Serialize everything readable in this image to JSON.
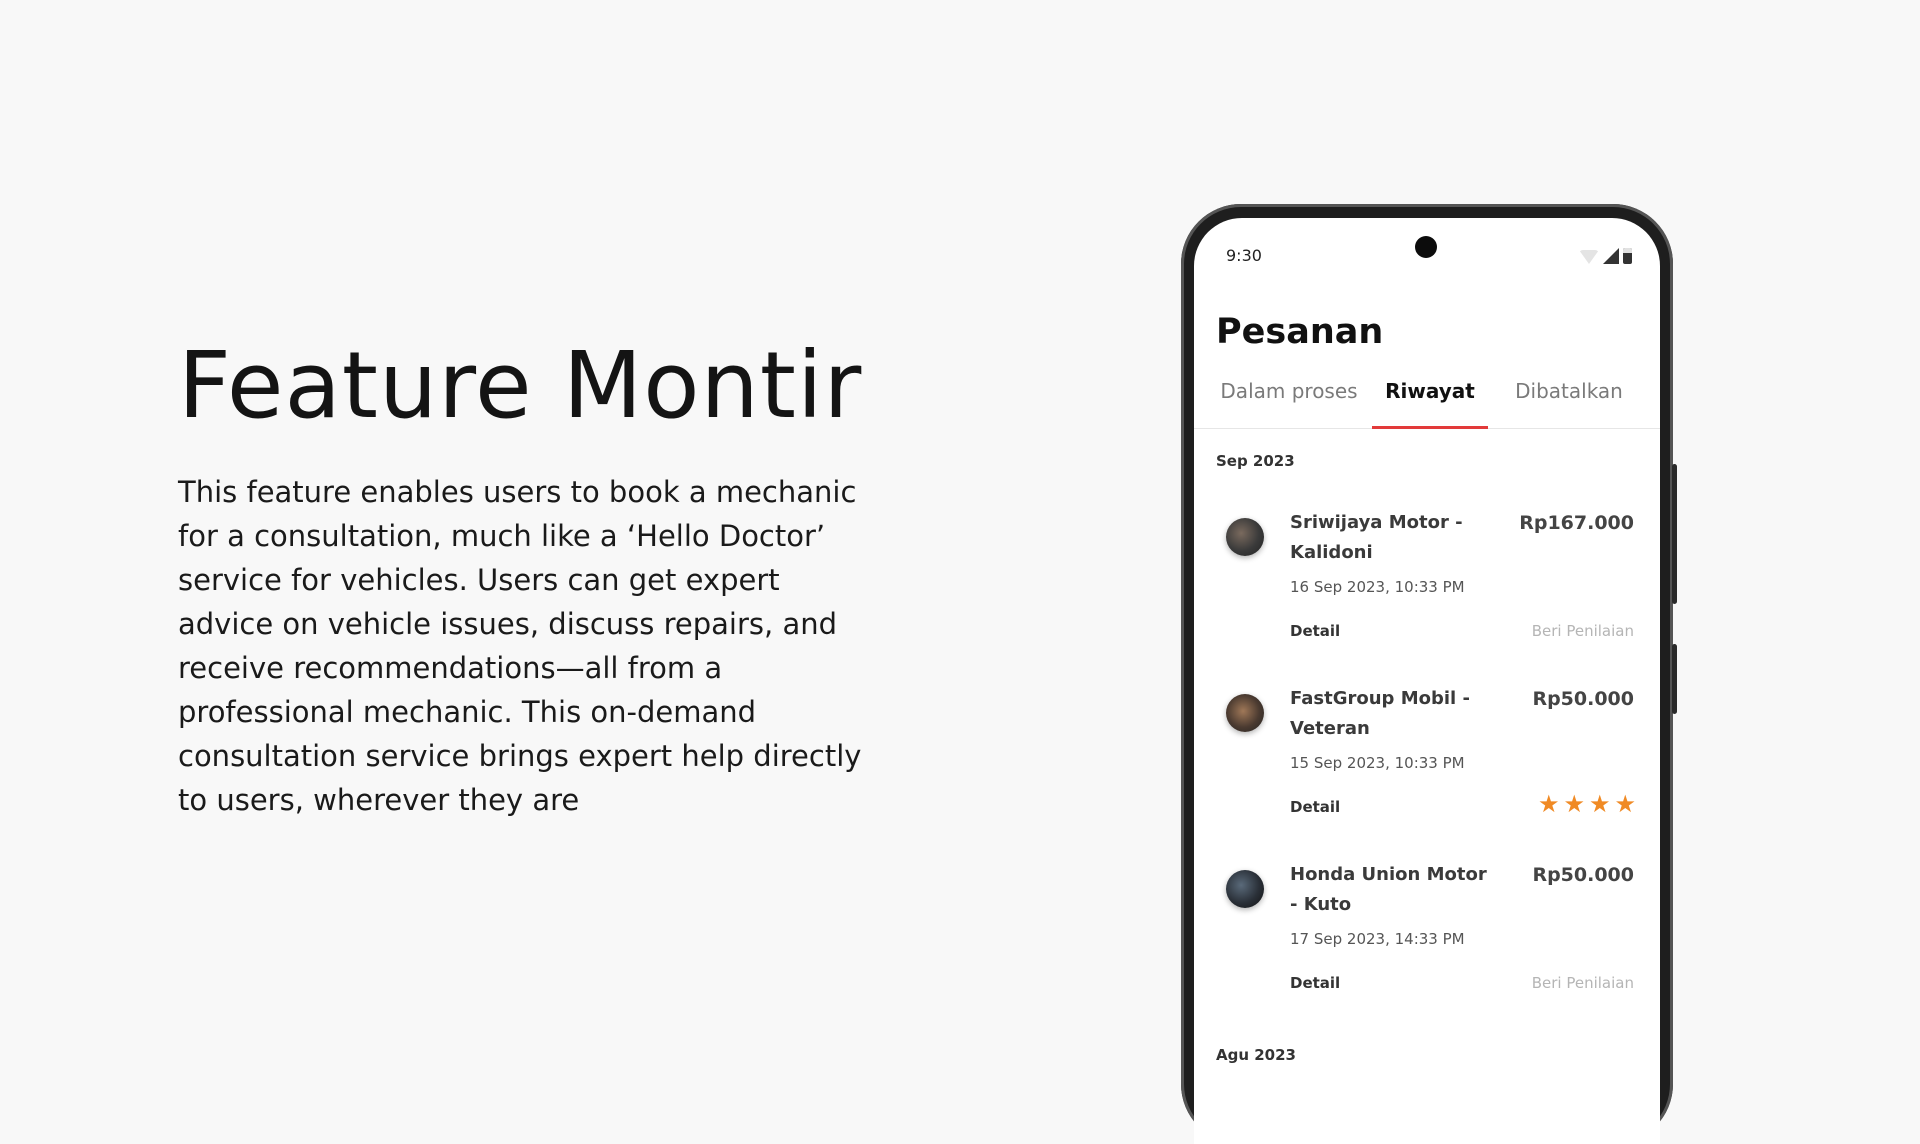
{
  "hero": {
    "title": "Feature Montir",
    "description": "This feature enables users to book a mechanic for a consultation, much like a ‘Hello Doctor’ service for vehicles. Users can get expert advice on vehicle issues, discuss repairs, and receive recommendations—all from a professional mechanic. This on-demand consultation service brings expert help directly to users, wherever they are"
  },
  "phone": {
    "status": {
      "time": "9:30",
      "icons": [
        "wifi-icon",
        "signal-icon",
        "battery-icon"
      ]
    },
    "page_title": "Pesanan",
    "tabs": [
      {
        "label": "Dalam proses",
        "active": false
      },
      {
        "label": "Riwayat",
        "active": true
      },
      {
        "label": "Dibatalkan",
        "active": false
      }
    ],
    "accent_color": "#e23a3a",
    "star_color": "#f08a24",
    "sections": [
      {
        "label": "Sep 2023",
        "orders": [
          {
            "shop": "Sriwijaya Motor - Kalidoni",
            "price": "Rp167.000",
            "date": "16 Sep 2023, 10:33 PM",
            "detail_label": "Detail",
            "rate_label": "Beri Penilaian"
          },
          {
            "shop": "FastGroup Mobil - Veteran",
            "price": "Rp50.000",
            "date": "15 Sep 2023, 10:33 PM",
            "detail_label": "Detail",
            "rating": 4
          },
          {
            "shop": "Honda Union Motor - Kuto",
            "price": "Rp50.000",
            "date": "17 Sep 2023, 14:33 PM",
            "detail_label": "Detail",
            "rate_label": "Beri Penilaian"
          }
        ]
      },
      {
        "label": "Agu 2023",
        "orders": []
      }
    ]
  }
}
